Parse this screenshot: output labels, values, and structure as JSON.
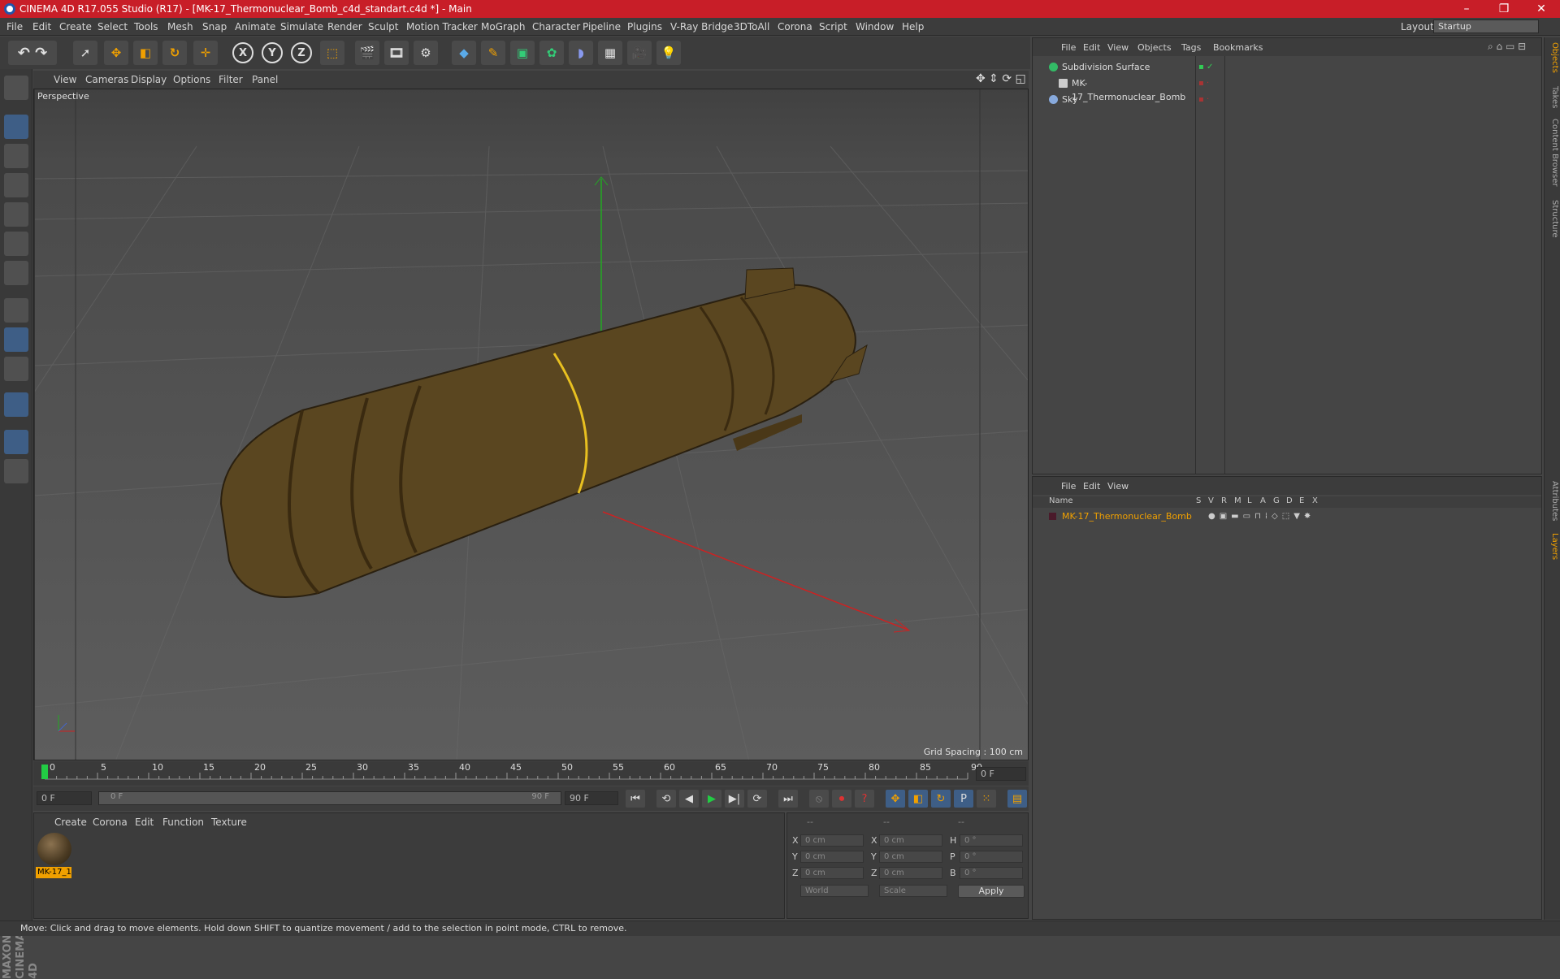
{
  "window": {
    "title": "CINEMA 4D R17.055 Studio (R17) - [MK-17_Thermonuclear_Bomb_c4d_standart.c4d *] - Main",
    "controls": [
      "–",
      "❐",
      "✕"
    ]
  },
  "menu": [
    "File",
    "Edit",
    "Create",
    "Select",
    "Tools",
    "Mesh",
    "Snap",
    "Animate",
    "Simulate",
    "Render",
    "Sculpt",
    "Motion Tracker",
    "MoGraph",
    "Character",
    "Pipeline",
    "Plugins",
    "V-Ray Bridge",
    "3DToAll",
    "Corona",
    "Script",
    "Window",
    "Help"
  ],
  "layout": {
    "label": "Layout:",
    "value": "Startup"
  },
  "toolbar_axes": [
    "X",
    "Y",
    "Z"
  ],
  "viewport": {
    "menu": [
      "View",
      "Cameras",
      "Display",
      "Options",
      "Filter",
      "Panel"
    ],
    "label": "Perspective",
    "grid_spacing": "Grid Spacing : 100 cm",
    "model_colors": {
      "body": "#5a4620",
      "highlight_ring": "#e8c020",
      "axis_x": "#cc2222",
      "axis_y": "#22aa22"
    }
  },
  "timeline": {
    "ticks": [
      "0",
      "5",
      "10",
      "15",
      "20",
      "25",
      "30",
      "35",
      "40",
      "45",
      "50",
      "55",
      "60",
      "65",
      "70",
      "75",
      "80",
      "85",
      "90"
    ],
    "current_frame": "0 F",
    "start_frame": "0 F",
    "range_start": "0 F",
    "range_end": "90 F",
    "end_frame": "90 F"
  },
  "materials": {
    "menu": [
      "Create",
      "Corona",
      "Edit",
      "Function",
      "Texture"
    ],
    "items": [
      {
        "name": "MK-17_1"
      }
    ]
  },
  "coords": {
    "header": [
      "--",
      "--",
      "--"
    ],
    "rows": [
      {
        "axis": "X",
        "pos": "0 cm",
        "size_axis": "X",
        "size": "0 cm",
        "rot_axis": "H",
        "rot": "0 °"
      },
      {
        "axis": "Y",
        "pos": "0 cm",
        "size_axis": "Y",
        "size": "0 cm",
        "rot_axis": "P",
        "rot": "0 °"
      },
      {
        "axis": "Z",
        "pos": "0 cm",
        "size_axis": "Z",
        "size": "0 cm",
        "rot_axis": "B",
        "rot": "0 °"
      }
    ],
    "mode": "World",
    "scale": "Scale",
    "apply": "Apply"
  },
  "objects": {
    "menu": [
      "File",
      "Edit",
      "View",
      "Objects",
      "Tags",
      "Bookmarks"
    ],
    "items": [
      {
        "name": "Subdivision Surface",
        "color": "#33bb66"
      },
      {
        "name": "MK-17_Thermonuclear_Bomb",
        "color": "#cccccc"
      },
      {
        "name": "Sky",
        "color": "#88aadd"
      }
    ]
  },
  "layers": {
    "menu": [
      "File",
      "Edit",
      "View"
    ],
    "columns": [
      "Name",
      "S",
      "V",
      "R",
      "M",
      "L",
      "A",
      "G",
      "D",
      "E",
      "X"
    ],
    "items": [
      {
        "name": "MK-17_Thermonuclear_Bomb",
        "color": "#f0a000"
      }
    ]
  },
  "side_tabs": [
    "Objects",
    "Takes",
    "Content Browser",
    "Structure",
    "Attributes",
    "Layers"
  ],
  "status": "Move: Click and drag to move elements. Hold down SHIFT to quantize movement / add to the selection in point mode, CTRL to remove."
}
